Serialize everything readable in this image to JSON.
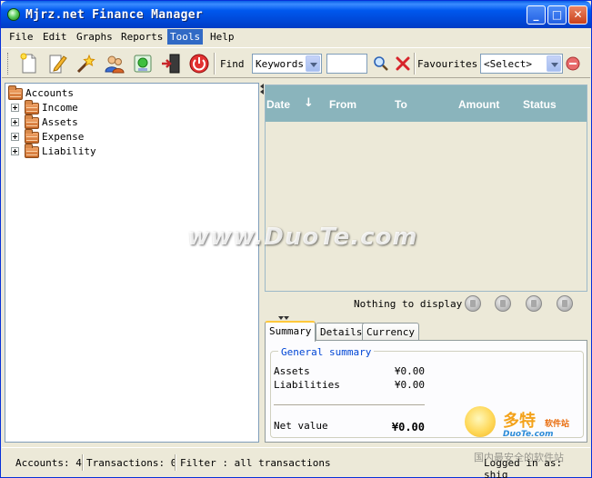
{
  "window": {
    "title": "Mjrz.net Finance Manager",
    "controls": {
      "minimize": "_",
      "maximize": "□",
      "close": "✕"
    }
  },
  "menu": [
    {
      "label": "File",
      "active": false
    },
    {
      "label": "Edit",
      "active": false
    },
    {
      "label": "Graphs",
      "active": false
    },
    {
      "label": "Reports",
      "active": false
    },
    {
      "label": "Tools",
      "active": true
    },
    {
      "label": "Help",
      "active": false
    }
  ],
  "toolbar": {
    "icons": [
      "new-document-icon",
      "edit-icon",
      "magic-wand-icon",
      "users-icon",
      "import-icon",
      "exit-icon",
      "power-icon"
    ],
    "find_label": "Find",
    "find_field": "Keywords",
    "search_text": "",
    "favourites_label": "Favourites",
    "favourites_value": "<Select>"
  },
  "tree": {
    "root": "Accounts",
    "children": [
      "Income",
      "Assets",
      "Expense",
      "Liability"
    ]
  },
  "grid": {
    "columns": [
      "Date",
      "From",
      "To",
      "Amount",
      "Status"
    ],
    "sorted_column": "Date",
    "sort_direction": "descending",
    "empty_text": "Nothing to display"
  },
  "tabs": [
    {
      "label": "Summary",
      "active": true
    },
    {
      "label": "Details",
      "active": false
    },
    {
      "label": "Currency",
      "active": false
    }
  ],
  "summary": {
    "group_title": "General summary",
    "assets_label": "Assets",
    "assets_value": "¥0.00",
    "liabilities_label": "Liabilities",
    "liabilities_value": "¥0.00",
    "net_label": "Net value",
    "net_value": "¥0.00"
  },
  "status": {
    "accounts": "Accounts: 4",
    "transactions": "Transactions: 0",
    "filter": "Filter : all transactions",
    "user": "Logged in as: shig"
  },
  "watermarks": {
    "center": "www.DuoTe.com",
    "corner_brand": "多特",
    "corner_brand_small": "软件站",
    "corner_domain": "DuoTe.com",
    "corner_slogan": "国内最安全的软件站"
  },
  "colors": {
    "titlebar": "#0058ee",
    "grid_header": "#8ab4bc",
    "menu_highlight": "#316ac5",
    "tab_highlight": "#ffc83c",
    "group_title": "#0046d5"
  }
}
